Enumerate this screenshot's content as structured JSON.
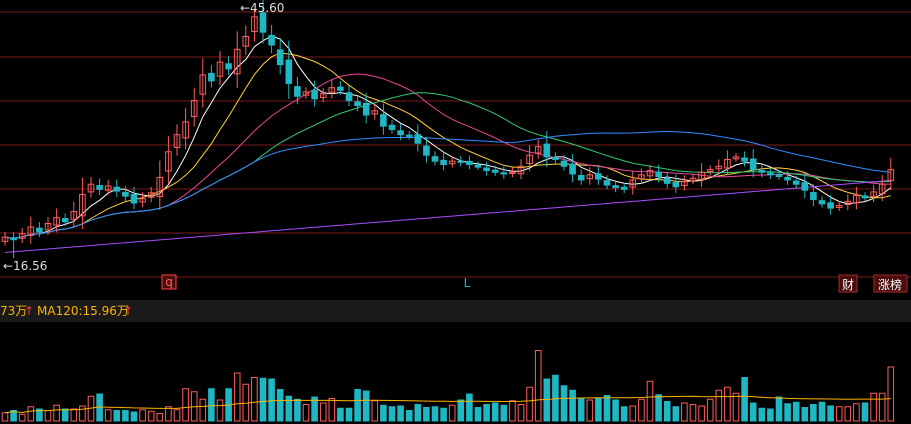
{
  "price_panel": {
    "high_label": "←45.60",
    "low_label": "←16.56",
    "marker_q": "q",
    "marker_l": "L",
    "badge_finance": "财",
    "badge_rank": "涨榜"
  },
  "volume_panel": {
    "ma_partial": "73万",
    "ma_partial_arrow": "↑",
    "ma120_label": "MA120:15.96万",
    "ma120_arrow": "↑"
  },
  "colors": {
    "background": "#000000",
    "up": "#ff5c5c",
    "down": "#1fb7c4",
    "grid": "#7a1c1c",
    "ma5": "#ffffff",
    "ma10": "#ffd23c",
    "ma20": "#e8479a",
    "ma30": "#2ecc71",
    "ma60": "#2f8cff",
    "ma120": "#a64dff",
    "vol_ma": "#ffb300",
    "label_text": "#dddddd",
    "ma120_text": "#ffb300",
    "separator": "#1a1a1a"
  },
  "chart_data": {
    "type": "candlestick",
    "price_range": [
      16.56,
      45.6
    ],
    "highest": 45.6,
    "lowest": 16.56,
    "closes": [
      19,
      18.7,
      19.4,
      20.2,
      19.6,
      20.6,
      21.3,
      20.8,
      22,
      24,
      25.2,
      24.6,
      25,
      24.4,
      23.8,
      23,
      23.5,
      24.2,
      26,
      29,
      31,
      32.5,
      35,
      38,
      37.3,
      39.5,
      38.7,
      41,
      42.5,
      44.8,
      43,
      41.5,
      39.2,
      37,
      35.5,
      36,
      35.2,
      35.8,
      36.5,
      36.2,
      35,
      34.4,
      33.3,
      33.8,
      32,
      31.6,
      31,
      30.8,
      30,
      28.6,
      27.9,
      27.5,
      27.9,
      27.8,
      27.5,
      27.2,
      26.8,
      26.6,
      26.4,
      26.6,
      27.3,
      28.6,
      29.6,
      28.4,
      28.1,
      27.3,
      26.4,
      25.7,
      26.3,
      25.8,
      25.1,
      24.8,
      24.6,
      25.7,
      26.3,
      26.8,
      26.1,
      25.3,
      24.9,
      25.5,
      25.9,
      26.6,
      26.9,
      27.3,
      28.1,
      28.4,
      27.9,
      26.9,
      26.6,
      26.3,
      26.1,
      25.7,
      25.2,
      24.5,
      23.4,
      22.9,
      22.4,
      22.7,
      23.2,
      23.9,
      23.6,
      24.3,
      25.2,
      26.9
    ],
    "volumes": [
      11,
      14,
      9,
      19,
      16,
      14,
      21,
      16,
      16,
      20,
      33,
      36,
      15,
      14,
      14,
      12,
      15,
      13,
      10,
      19,
      15,
      43,
      39,
      29,
      43,
      28,
      43,
      64,
      49,
      58,
      57,
      56,
      42,
      33,
      29,
      22,
      32,
      24,
      30,
      17,
      17,
      42,
      40,
      27,
      21,
      19,
      20,
      14,
      22,
      18,
      19,
      17,
      21,
      28,
      36,
      18,
      22,
      24,
      21,
      27,
      22,
      45,
      94,
      56,
      61,
      47,
      41,
      30,
      28,
      30,
      34,
      28,
      19,
      20,
      29,
      53,
      35,
      26,
      19,
      24,
      22,
      20,
      29,
      41,
      45,
      37,
      58,
      24,
      17,
      16,
      32,
      23,
      25,
      18,
      22,
      25,
      20,
      19,
      19,
      23,
      24,
      37,
      37,
      72
    ],
    "indicators": [
      "MA5",
      "MA10",
      "MA20",
      "MA30",
      "MA60",
      "MA120"
    ]
  }
}
